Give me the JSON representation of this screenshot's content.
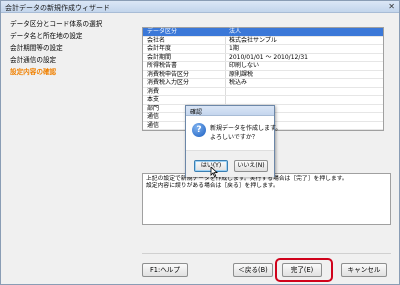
{
  "window": {
    "title": "会計データの新規作成ウィザード",
    "close_glyph": "✕"
  },
  "nav": {
    "items": [
      {
        "label": "データ区分とコード体系の選択",
        "active": false
      },
      {
        "label": "データ名と所在地の設定",
        "active": false
      },
      {
        "label": "会計期間等の設定",
        "active": false
      },
      {
        "label": "会計通信の設定",
        "active": false
      },
      {
        "label": "設定内容の確認",
        "active": true
      }
    ]
  },
  "table": {
    "header": [
      "データ区分",
      "法人"
    ],
    "rows": [
      [
        "会社名",
        "株式会社サンプル"
      ],
      [
        "会計年度",
        "1期"
      ],
      [
        "会計期間",
        "2010/01/01 ～ 2010/12/31"
      ],
      [
        "所得税告書",
        "印刷しない"
      ],
      [
        "消費税申告区分",
        "原則課税"
      ],
      [
        "消費税入力区分",
        "税込み"
      ],
      [
        "消費",
        ""
      ],
      [
        "本支",
        ""
      ],
      [
        "部門",
        ""
      ],
      [
        "通信",
        ""
      ],
      [
        "通信",
        ""
      ]
    ]
  },
  "description": {
    "line1": "上記の設定で新規データを作成します。実行する場合は［完了］を押します。",
    "line2": "設定内容に誤りがある場合は［戻る］を押します。"
  },
  "buttons": {
    "help": "F1:ヘルプ",
    "back": "＜戻る(B)",
    "finish": "完了(E)",
    "cancel": "キャンセル"
  },
  "dialog": {
    "title": "確認",
    "icon": "question-icon",
    "message_line1": "新規データを作成します。",
    "message_line2": "よろしいですか？",
    "yes": "はい(Y)",
    "no": "いいえ(N)"
  },
  "colors": {
    "active_nav": "#f08000",
    "table_header": "#3b78d8",
    "highlight": "#d0021b"
  }
}
